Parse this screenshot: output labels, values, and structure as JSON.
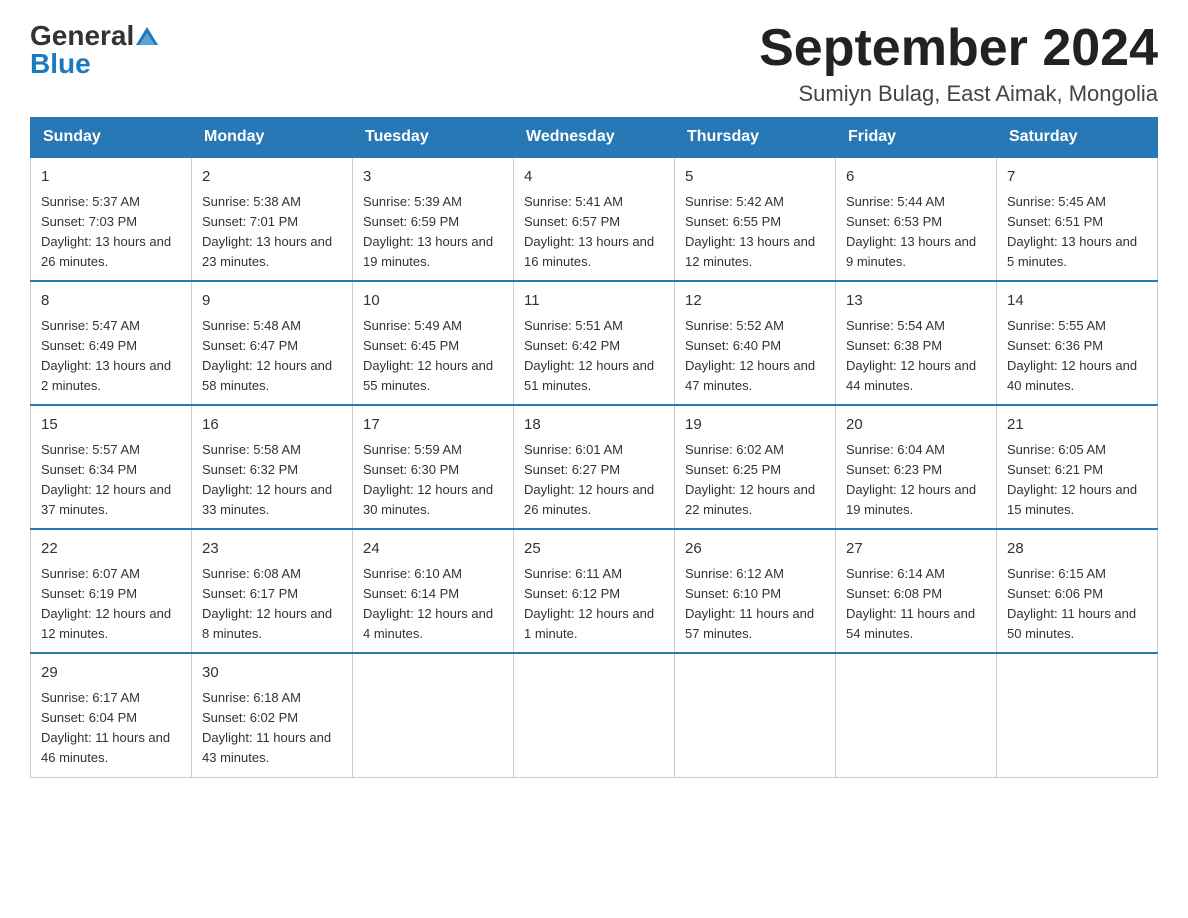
{
  "header": {
    "logo_general": "General",
    "logo_blue": "Blue",
    "month_title": "September 2024",
    "subtitle": "Sumiyn Bulag, East Aimak, Mongolia"
  },
  "weekdays": [
    "Sunday",
    "Monday",
    "Tuesday",
    "Wednesday",
    "Thursday",
    "Friday",
    "Saturday"
  ],
  "weeks": [
    [
      {
        "day": "1",
        "sunrise": "Sunrise: 5:37 AM",
        "sunset": "Sunset: 7:03 PM",
        "daylight": "Daylight: 13 hours and 26 minutes."
      },
      {
        "day": "2",
        "sunrise": "Sunrise: 5:38 AM",
        "sunset": "Sunset: 7:01 PM",
        "daylight": "Daylight: 13 hours and 23 minutes."
      },
      {
        "day": "3",
        "sunrise": "Sunrise: 5:39 AM",
        "sunset": "Sunset: 6:59 PM",
        "daylight": "Daylight: 13 hours and 19 minutes."
      },
      {
        "day": "4",
        "sunrise": "Sunrise: 5:41 AM",
        "sunset": "Sunset: 6:57 PM",
        "daylight": "Daylight: 13 hours and 16 minutes."
      },
      {
        "day": "5",
        "sunrise": "Sunrise: 5:42 AM",
        "sunset": "Sunset: 6:55 PM",
        "daylight": "Daylight: 13 hours and 12 minutes."
      },
      {
        "day": "6",
        "sunrise": "Sunrise: 5:44 AM",
        "sunset": "Sunset: 6:53 PM",
        "daylight": "Daylight: 13 hours and 9 minutes."
      },
      {
        "day": "7",
        "sunrise": "Sunrise: 5:45 AM",
        "sunset": "Sunset: 6:51 PM",
        "daylight": "Daylight: 13 hours and 5 minutes."
      }
    ],
    [
      {
        "day": "8",
        "sunrise": "Sunrise: 5:47 AM",
        "sunset": "Sunset: 6:49 PM",
        "daylight": "Daylight: 13 hours and 2 minutes."
      },
      {
        "day": "9",
        "sunrise": "Sunrise: 5:48 AM",
        "sunset": "Sunset: 6:47 PM",
        "daylight": "Daylight: 12 hours and 58 minutes."
      },
      {
        "day": "10",
        "sunrise": "Sunrise: 5:49 AM",
        "sunset": "Sunset: 6:45 PM",
        "daylight": "Daylight: 12 hours and 55 minutes."
      },
      {
        "day": "11",
        "sunrise": "Sunrise: 5:51 AM",
        "sunset": "Sunset: 6:42 PM",
        "daylight": "Daylight: 12 hours and 51 minutes."
      },
      {
        "day": "12",
        "sunrise": "Sunrise: 5:52 AM",
        "sunset": "Sunset: 6:40 PM",
        "daylight": "Daylight: 12 hours and 47 minutes."
      },
      {
        "day": "13",
        "sunrise": "Sunrise: 5:54 AM",
        "sunset": "Sunset: 6:38 PM",
        "daylight": "Daylight: 12 hours and 44 minutes."
      },
      {
        "day": "14",
        "sunrise": "Sunrise: 5:55 AM",
        "sunset": "Sunset: 6:36 PM",
        "daylight": "Daylight: 12 hours and 40 minutes."
      }
    ],
    [
      {
        "day": "15",
        "sunrise": "Sunrise: 5:57 AM",
        "sunset": "Sunset: 6:34 PM",
        "daylight": "Daylight: 12 hours and 37 minutes."
      },
      {
        "day": "16",
        "sunrise": "Sunrise: 5:58 AM",
        "sunset": "Sunset: 6:32 PM",
        "daylight": "Daylight: 12 hours and 33 minutes."
      },
      {
        "day": "17",
        "sunrise": "Sunrise: 5:59 AM",
        "sunset": "Sunset: 6:30 PM",
        "daylight": "Daylight: 12 hours and 30 minutes."
      },
      {
        "day": "18",
        "sunrise": "Sunrise: 6:01 AM",
        "sunset": "Sunset: 6:27 PM",
        "daylight": "Daylight: 12 hours and 26 minutes."
      },
      {
        "day": "19",
        "sunrise": "Sunrise: 6:02 AM",
        "sunset": "Sunset: 6:25 PM",
        "daylight": "Daylight: 12 hours and 22 minutes."
      },
      {
        "day": "20",
        "sunrise": "Sunrise: 6:04 AM",
        "sunset": "Sunset: 6:23 PM",
        "daylight": "Daylight: 12 hours and 19 minutes."
      },
      {
        "day": "21",
        "sunrise": "Sunrise: 6:05 AM",
        "sunset": "Sunset: 6:21 PM",
        "daylight": "Daylight: 12 hours and 15 minutes."
      }
    ],
    [
      {
        "day": "22",
        "sunrise": "Sunrise: 6:07 AM",
        "sunset": "Sunset: 6:19 PM",
        "daylight": "Daylight: 12 hours and 12 minutes."
      },
      {
        "day": "23",
        "sunrise": "Sunrise: 6:08 AM",
        "sunset": "Sunset: 6:17 PM",
        "daylight": "Daylight: 12 hours and 8 minutes."
      },
      {
        "day": "24",
        "sunrise": "Sunrise: 6:10 AM",
        "sunset": "Sunset: 6:14 PM",
        "daylight": "Daylight: 12 hours and 4 minutes."
      },
      {
        "day": "25",
        "sunrise": "Sunrise: 6:11 AM",
        "sunset": "Sunset: 6:12 PM",
        "daylight": "Daylight: 12 hours and 1 minute."
      },
      {
        "day": "26",
        "sunrise": "Sunrise: 6:12 AM",
        "sunset": "Sunset: 6:10 PM",
        "daylight": "Daylight: 11 hours and 57 minutes."
      },
      {
        "day": "27",
        "sunrise": "Sunrise: 6:14 AM",
        "sunset": "Sunset: 6:08 PM",
        "daylight": "Daylight: 11 hours and 54 minutes."
      },
      {
        "day": "28",
        "sunrise": "Sunrise: 6:15 AM",
        "sunset": "Sunset: 6:06 PM",
        "daylight": "Daylight: 11 hours and 50 minutes."
      }
    ],
    [
      {
        "day": "29",
        "sunrise": "Sunrise: 6:17 AM",
        "sunset": "Sunset: 6:04 PM",
        "daylight": "Daylight: 11 hours and 46 minutes."
      },
      {
        "day": "30",
        "sunrise": "Sunrise: 6:18 AM",
        "sunset": "Sunset: 6:02 PM",
        "daylight": "Daylight: 11 hours and 43 minutes."
      },
      null,
      null,
      null,
      null,
      null
    ]
  ]
}
